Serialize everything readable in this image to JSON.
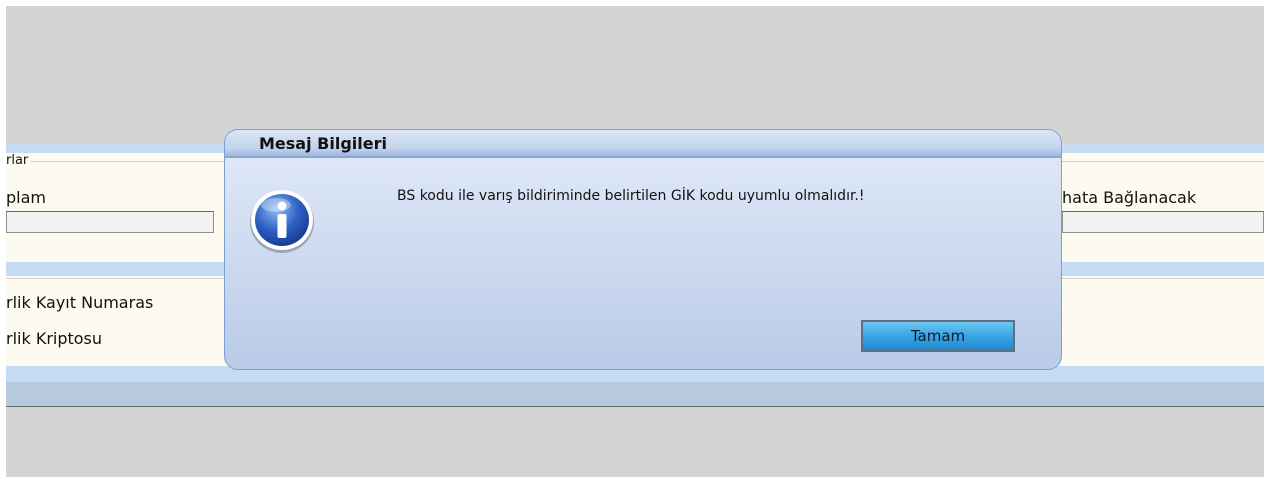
{
  "background": {
    "fieldset_legend": "rlar",
    "row_left_label": "plam",
    "row_right_label": "hata Bağlanacak",
    "lower_label_1": "rlik Kayıt Numaras",
    "lower_label_2": "rlik Kriptosu"
  },
  "dialog": {
    "title": "Mesaj Bilgileri",
    "icon": "info-icon",
    "message": "BS kodu ile varış bildiriminde belirtilen GİK kodu uyumlu olmalıdır.!",
    "ok_label": "Tamam"
  },
  "colors": {
    "accent": "#3aa5e3",
    "dialog_border": "#7e9fd0",
    "backdrop": "#d4d4d4"
  }
}
